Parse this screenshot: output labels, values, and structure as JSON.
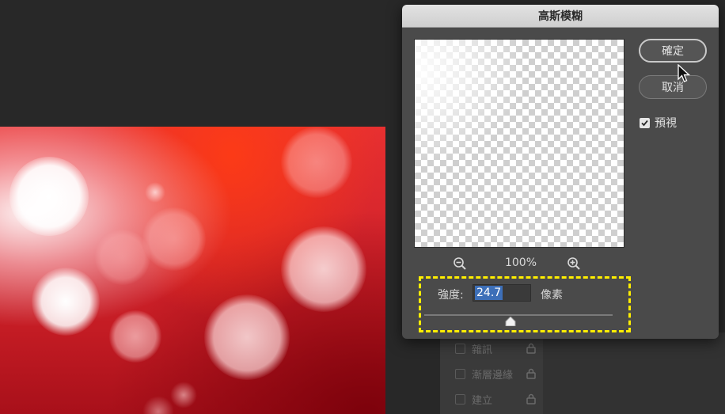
{
  "dialog": {
    "title": "高斯模糊",
    "ok_label": "確定",
    "cancel_label": "取消",
    "preview_label": "預視",
    "preview_checked": true,
    "zoom_level": "100%",
    "radius_label": "強度:",
    "radius_value": "24.7",
    "radius_unit": "像素",
    "slider_fraction": 0.46
  },
  "layers_panel": {
    "lock_items": [
      {
        "label": "雜訊"
      },
      {
        "label": "漸層邊緣"
      },
      {
        "label": "建立"
      }
    ]
  },
  "colors": {
    "highlight": "#ffee00",
    "selection": "#3d6fb8",
    "image_red": "#d4242c"
  },
  "icons": {
    "zoom_out": "zoom-out-icon",
    "zoom_in": "zoom-in-icon",
    "lock": "lock-icon",
    "cursor": "mouse-pointer-icon"
  }
}
